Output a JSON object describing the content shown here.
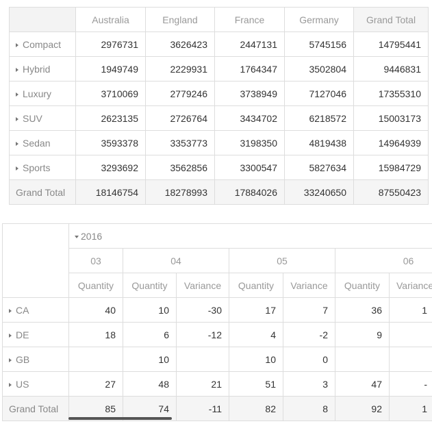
{
  "pivot1": {
    "columns": [
      "Australia",
      "England",
      "France",
      "Germany",
      "Grand Total"
    ],
    "rows": [
      {
        "label": "Compact",
        "values": [
          "2976731",
          "3626423",
          "2447131",
          "5745156",
          "14795441"
        ]
      },
      {
        "label": "Hybrid",
        "values": [
          "1949749",
          "2229931",
          "1764347",
          "3502804",
          "9446831"
        ]
      },
      {
        "label": "Luxury",
        "values": [
          "3710069",
          "2779246",
          "3738949",
          "7127046",
          "17355310"
        ]
      },
      {
        "label": "SUV",
        "values": [
          "2623135",
          "2726764",
          "3434702",
          "6218572",
          "15003173"
        ]
      },
      {
        "label": "Sedan",
        "values": [
          "3593378",
          "3353773",
          "3198350",
          "4819438",
          "14964939"
        ]
      },
      {
        "label": "Sports",
        "values": [
          "3293692",
          "3562856",
          "3300547",
          "5827634",
          "15984729"
        ]
      }
    ],
    "grand_total": {
      "label": "Grand Total",
      "values": [
        "18146754",
        "18278993",
        "17884026",
        "33240650",
        "87550423"
      ]
    }
  },
  "pivot2": {
    "year": "2016",
    "months": [
      "03",
      "04",
      "05",
      "06"
    ],
    "measures": [
      "Quantity",
      "Quantity",
      "Variance",
      "Quantity",
      "Variance",
      "Quantity",
      "Variance"
    ],
    "rows": [
      {
        "label": "CA",
        "values": [
          "40",
          "10",
          "-30",
          "17",
          "7",
          "36",
          "1"
        ]
      },
      {
        "label": "DE",
        "values": [
          "18",
          "6",
          "-12",
          "4",
          "-2",
          "9",
          ""
        ]
      },
      {
        "label": "GB",
        "values": [
          "",
          "10",
          "",
          "10",
          "0",
          "",
          ""
        ]
      },
      {
        "label": "US",
        "values": [
          "27",
          "48",
          "21",
          "51",
          "3",
          "47",
          "-"
        ]
      }
    ],
    "grand_total": {
      "label": "Grand Total",
      "values": [
        "85",
        "74",
        "-11",
        "82",
        "8",
        "92",
        "1"
      ]
    }
  }
}
